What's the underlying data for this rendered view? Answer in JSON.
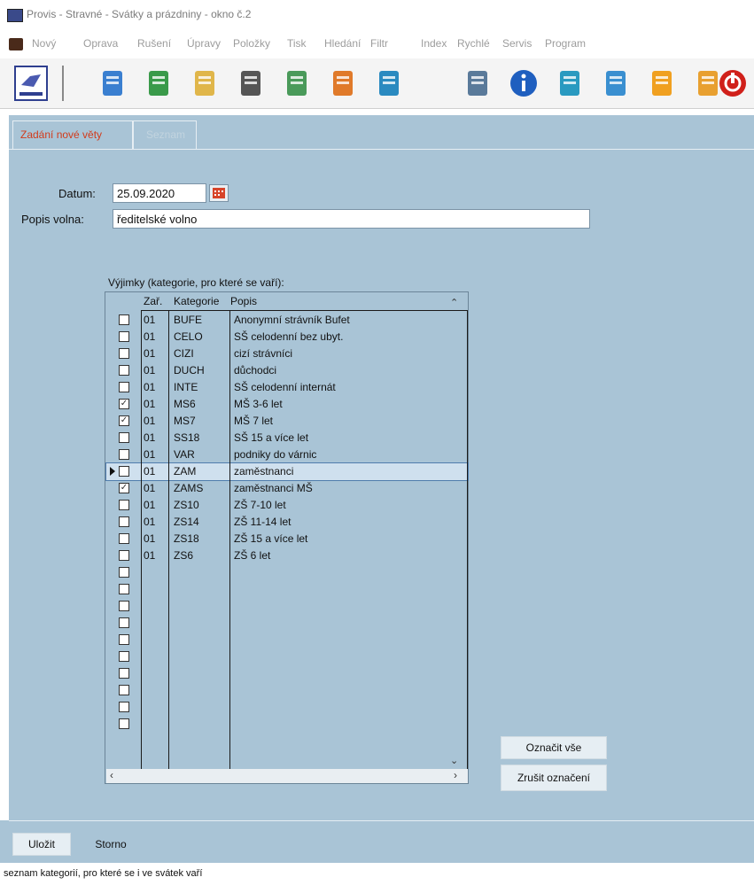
{
  "window": {
    "title": "Provis - Stravné - Svátky a prázdniny - okno č.2"
  },
  "menu": [
    {
      "label": "Nový",
      "key": "N"
    },
    {
      "label": "Oprava",
      "key": "O"
    },
    {
      "label": "Rušení",
      "key": "R"
    },
    {
      "label": "Úpravy",
      "key": "v"
    },
    {
      "label": "Položky",
      "key": "P"
    },
    {
      "label": "Tisk",
      "key": "T"
    },
    {
      "label": "Hledání",
      "key": "H"
    },
    {
      "label": "Filtr",
      "key": "F"
    },
    {
      "label": "Index",
      "key": "I"
    },
    {
      "label": "Rychlé",
      "key": "y"
    },
    {
      "label": "Servis",
      "key": "S"
    },
    {
      "label": "Program",
      "key": "g"
    }
  ],
  "toolbar": {
    "items": [
      "provis-logo-icon",
      "calendar-refresh-icon",
      "recycle-icon",
      "document-add-icon",
      "phone-icon",
      "document-delete-icon",
      "document-edit-icon",
      "broom-icon",
      "search-icon",
      "info-icon",
      "cup-icon",
      "arrows-icon",
      "pencil-icon",
      "folder-icon",
      "power-icon"
    ]
  },
  "tabs": [
    {
      "label": "Zadání nové věty",
      "active": true
    },
    {
      "label": "Seznam",
      "active": false
    }
  ],
  "form": {
    "datum_label": "Datum:",
    "datum_value": "25.09.2020",
    "popis_label": "Popis volna:",
    "popis_value": "ředitelské volno"
  },
  "grid": {
    "caption": "Výjimky (kategorie, pro které se vaří):",
    "columns": [
      "Zař.",
      "Kategorie",
      "Popis"
    ],
    "rows": [
      {
        "checked": false,
        "zar": "01",
        "kat": "BUFE",
        "popis": "Anonymní strávník Bufet"
      },
      {
        "checked": false,
        "zar": "01",
        "kat": "CELO",
        "popis": "SŠ celodenní bez ubyt."
      },
      {
        "checked": false,
        "zar": "01",
        "kat": "CIZI",
        "popis": "cizí strávníci"
      },
      {
        "checked": false,
        "zar": "01",
        "kat": "DUCH",
        "popis": "důchodci"
      },
      {
        "checked": false,
        "zar": "01",
        "kat": "INTE",
        "popis": "SŠ celodenní internát"
      },
      {
        "checked": true,
        "zar": "01",
        "kat": "MS6",
        "popis": "MŠ 3-6 let"
      },
      {
        "checked": true,
        "zar": "01",
        "kat": "MS7",
        "popis": "MŠ 7 let"
      },
      {
        "checked": false,
        "zar": "01",
        "kat": "SS18",
        "popis": "SŠ 15 a více let"
      },
      {
        "checked": false,
        "zar": "01",
        "kat": "VAR",
        "popis": "podniky do várnic"
      },
      {
        "checked": false,
        "zar": "01",
        "kat": "ZAM",
        "popis": "zaměstnanci",
        "current": true
      },
      {
        "checked": true,
        "zar": "01",
        "kat": "ZAMS",
        "popis": "zaměstnanci MŠ"
      },
      {
        "checked": false,
        "zar": "01",
        "kat": "ZS10",
        "popis": "ZŠ 7-10 let"
      },
      {
        "checked": false,
        "zar": "01",
        "kat": "ZS14",
        "popis": "ZŠ 11-14 let"
      },
      {
        "checked": false,
        "zar": "01",
        "kat": "ZS18",
        "popis": "ZŠ 15 a více let"
      },
      {
        "checked": false,
        "zar": "01",
        "kat": "ZS6",
        "popis": "ZŠ 6 let"
      }
    ],
    "empty_rows": 10
  },
  "buttons": {
    "select_all": "Označit vše",
    "deselect": "Zrušit označení",
    "save": "Uložit",
    "cancel": "Storno"
  },
  "status": {
    "text": "seznam kategorií, pro které se i ve svátek vaří"
  }
}
